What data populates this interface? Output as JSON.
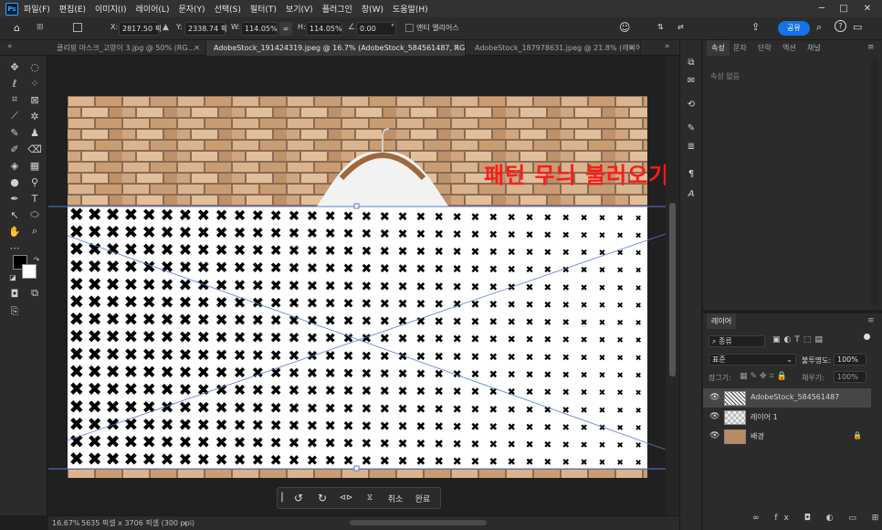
{
  "app": {
    "logo": "Ps"
  },
  "menu": [
    "파일(F)",
    "편집(E)",
    "이미지(I)",
    "레이어(L)",
    "문자(Y)",
    "선택(S)",
    "필터(T)",
    "보기(V)",
    "플러그인",
    "창(W)",
    "도움말(H)"
  ],
  "window_controls": {
    "minimize": "─",
    "maximize": "□",
    "close": "✕"
  },
  "options_bar": {
    "x_label": "X:",
    "x_value": "2817.50 픽",
    "y_label": "Y:",
    "y_value": "2338.74 픽",
    "w_label": "W:",
    "w_value": "114.05%",
    "h_label": "H:",
    "h_value": "114.05%",
    "angle_value": "0.00",
    "angle_unit": "°",
    "antialias_label": "앤티 앨리어스",
    "share_label": "공유"
  },
  "tabs": [
    {
      "label": "클리핑 마스크_고양이 3.jpg @ 50% (RG...",
      "active": false
    },
    {
      "label": "AdobeStock_191424319.jpeg @ 16.7% (AdobeStock_584561487, RGB/8) *",
      "active": true
    },
    {
      "label": "AdobeStock_187978631.jpeg @ 21.8% (레이어...",
      "active": false
    }
  ],
  "canvas": {
    "overlay_text": "패턴 무늬 불러오기",
    "pattern_glyph": "✖"
  },
  "transform_bar": {
    "cancel_label": "취소",
    "confirm_label": "완료"
  },
  "status": {
    "zoom": "16.67%",
    "doc_info": "5635 픽셀 x 3706 픽셀 (300 ppi)"
  },
  "properties_panel": {
    "tabs": [
      "속성",
      "문자",
      "단락",
      "액션",
      "채널"
    ],
    "empty_text": "속성 없음"
  },
  "layers_panel": {
    "title": "레이어",
    "search_placeholder": "종류",
    "blend_mode": "표준",
    "opacity_label": "불투명도:",
    "opacity_value": "100%",
    "lock_label": "잠그기:",
    "fill_label": "채우기:",
    "fill_value": "100%",
    "layers": [
      {
        "name": "AdobeStock_584561487",
        "selected": true,
        "locked": false
      },
      {
        "name": "레이어 1",
        "selected": false,
        "locked": false
      },
      {
        "name": "배경",
        "selected": false,
        "locked": true
      }
    ]
  },
  "colors": {
    "accent": "#1473e6",
    "overlay_text": "#ff1a1a",
    "brick": "#c9a07a"
  }
}
